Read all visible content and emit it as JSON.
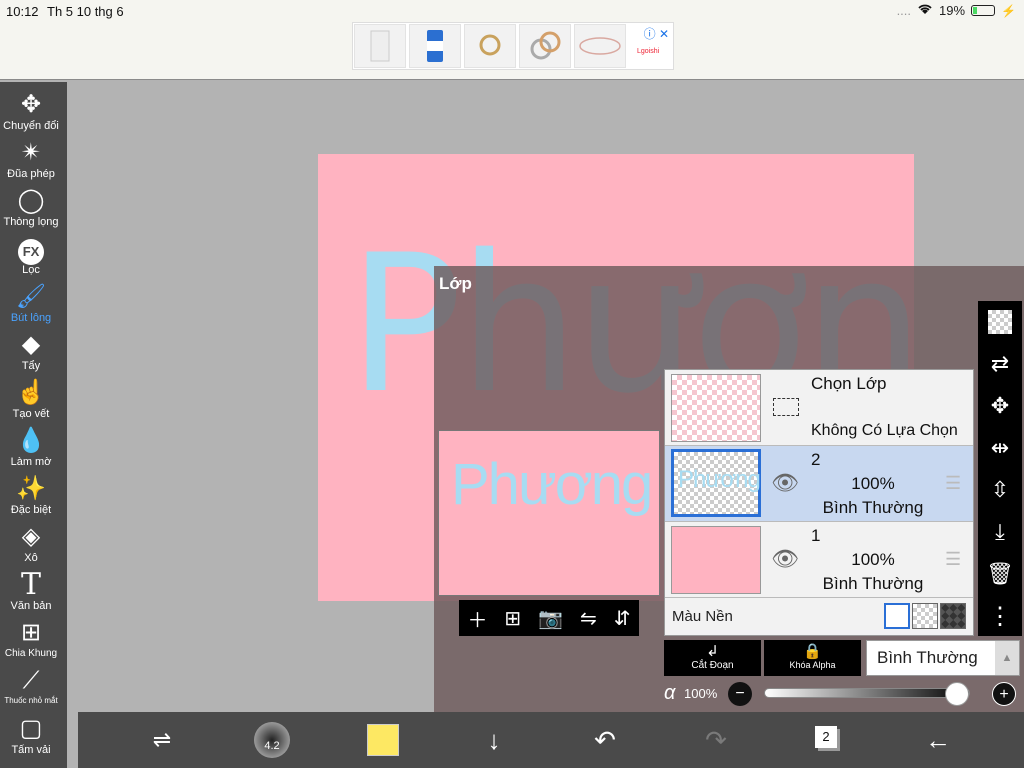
{
  "status": {
    "time": "10:12",
    "date": "Th 5 10 thg 6",
    "signal": "....",
    "battery": "19%"
  },
  "ad": {
    "brand": "Lgoishi"
  },
  "toolbar": {
    "items": [
      {
        "label": "Chuyển đổi",
        "icon": "move-icon"
      },
      {
        "label": "Đũa phép",
        "icon": "magic-wand-icon"
      },
      {
        "label": "Thòng lọng",
        "icon": "lasso-icon"
      },
      {
        "label": "Lọc",
        "icon": "fx-icon"
      },
      {
        "label": "Bút lông",
        "icon": "brush-icon"
      },
      {
        "label": "Tẩy",
        "icon": "eraser-icon"
      },
      {
        "label": "Tạo vết",
        "icon": "smudge-icon"
      },
      {
        "label": "Làm mờ",
        "icon": "blur-icon"
      },
      {
        "label": "Đặc biệt",
        "icon": "special-icon"
      },
      {
        "label": "Xô",
        "icon": "bucket-icon"
      },
      {
        "label": "Văn bản",
        "icon": "text-icon"
      },
      {
        "label": "Chia Khung",
        "icon": "frame-divider-icon"
      },
      {
        "label": "Thuốc nhỏ mắt",
        "icon": "eyedropper-icon"
      },
      {
        "label": "Tấm vải",
        "icon": "canvas-icon"
      }
    ],
    "active": "Bút lông",
    "active_color": "#4aa3ff"
  },
  "canvas": {
    "text": "Phương",
    "bg_color": "#ffb3c1",
    "text_color": "#a7dcf2"
  },
  "layer_panel": {
    "title": "Lớp",
    "selection": {
      "title": "Chọn Lớp",
      "status": "Không Có Lựa Chọn"
    },
    "layers": [
      {
        "number": "2",
        "opacity": "100%",
        "blend": "Bình Thường",
        "selected": true
      },
      {
        "number": "1",
        "opacity": "100%",
        "blend": "Bình Thường",
        "selected": false
      }
    ],
    "background_label": "Màu Nền",
    "clipping_label": "Cắt Đoạn",
    "alpha_lock_label": "Khóa Alpha",
    "blend_mode": "Bình Thường",
    "opacity_value": "100%",
    "opacity_fraction": 1.0
  },
  "bottombar": {
    "brush_size": "4.2",
    "color": "#fde863",
    "layer_count": "2"
  }
}
